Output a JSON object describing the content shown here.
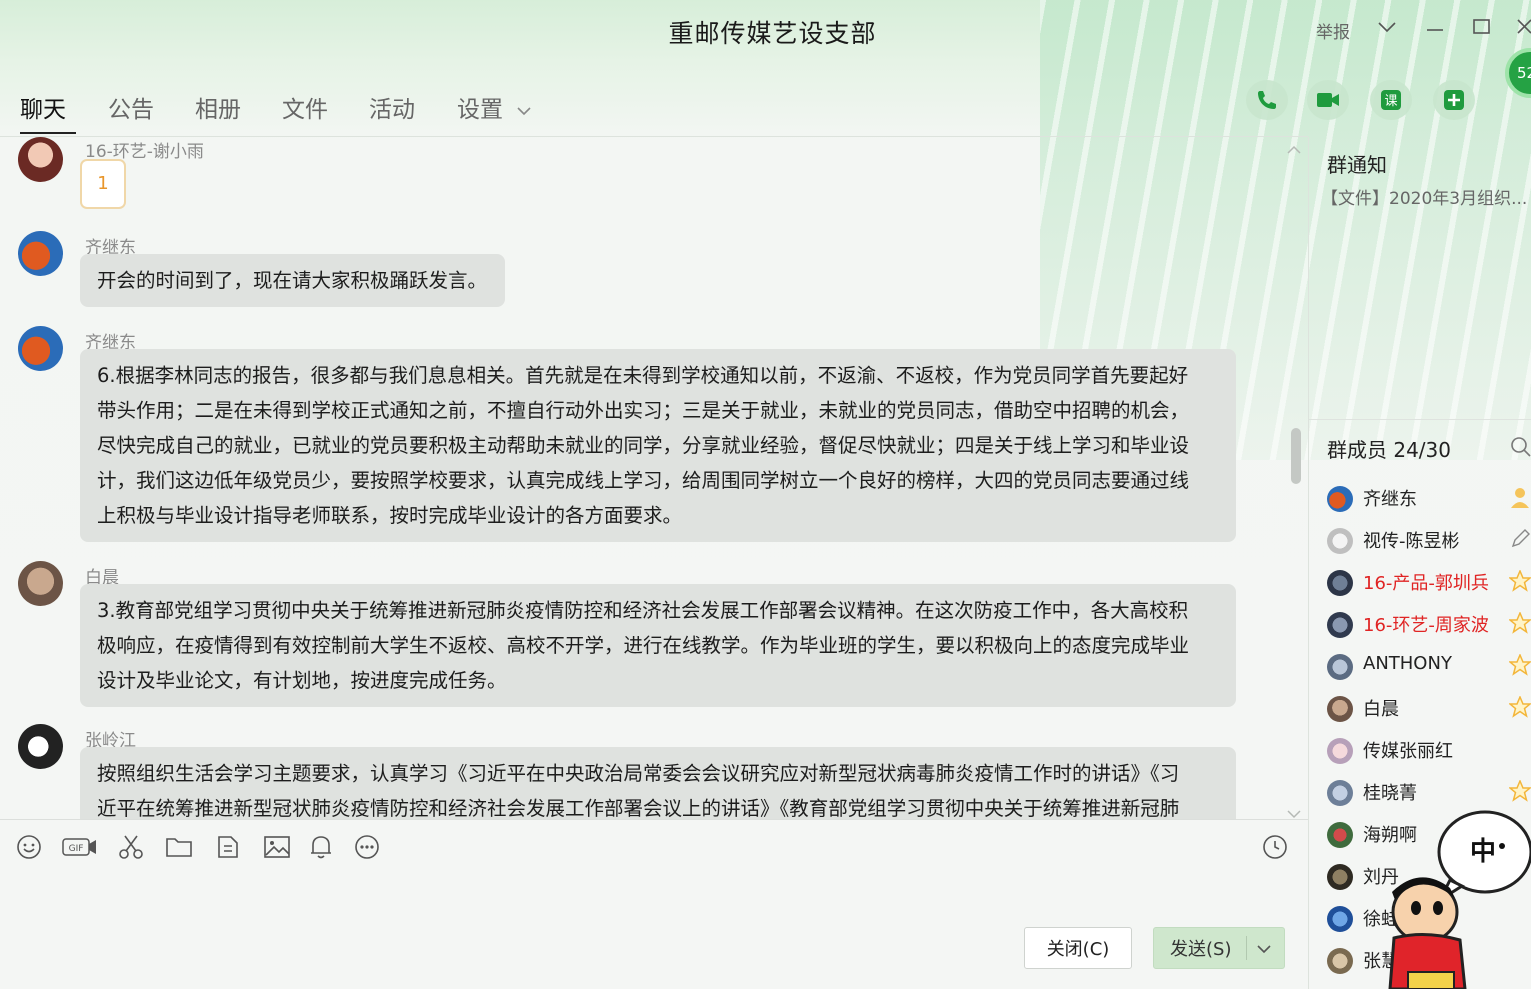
{
  "window": {
    "title": "重邮传媒艺设支部",
    "report_label": "举报"
  },
  "tabs": [
    {
      "label": "聊天",
      "active": true
    },
    {
      "label": "公告"
    },
    {
      "label": "相册"
    },
    {
      "label": "文件"
    },
    {
      "label": "活动"
    },
    {
      "label": "设置"
    }
  ],
  "header_badge": "52",
  "messages": [
    {
      "sender": "16-环艺-谢小雨",
      "emoji_value": "1"
    },
    {
      "sender": "齐继东",
      "lines": [
        "开会的时间到了，现在请大家积极踊跃发言。"
      ]
    },
    {
      "sender": "齐继东",
      "lines": [
        "6.根据李林同志的报告，很多都与我们息息相关。首先就是在未得到学校通知以前，不返渝、不返校，作为党员同学首先要起好",
        "带头作用；二是在未得到学校正式通知之前，不擅自行动外出实习；三是关于就业，未就业的党员同志，借助空中招聘的机会，",
        "尽快完成自己的就业，已就业的党员要积极主动帮助未就业的同学，分享就业经验，督促尽快就业；四是关于线上学习和毕业设",
        "计，我们这边低年级党员少，要按照学校要求，认真完成线上学习，给周围同学树立一个良好的榜样，大四的党员同志要通过线",
        "上积极与毕业设计指导老师联系，按时完成毕业设计的各方面要求。"
      ]
    },
    {
      "sender": "白晨",
      "lines": [
        "3.教育部党组学习贯彻中央关于统筹推进新冠肺炎疫情防控和经济社会发展工作部署会议精神。在这次防疫工作中，各大高校积",
        "极响应，在疫情得到有效控制前大学生不返校、高校不开学，进行在线教学。作为毕业班的学生，要以积极向上的态度完成毕业",
        "设计及毕业论文，有计划地，按进度完成任务。"
      ]
    },
    {
      "sender": "张岭江",
      "lines": [
        "按照组织生活会学习主题要求，认真学习《习近平在中央政治局常委会会议研究应对新型冠状病毒肺炎疫情工作时的讲话》《习",
        "近平在统筹推进新型冠状肺炎疫情防控和经济社会发展工作部署会议上的讲话》《教育部党组学习贯彻中央关于统筹推进新冠肺"
      ]
    }
  ],
  "buttons": {
    "close": "关闭(C)",
    "send": "发送(S)"
  },
  "notice": {
    "title": "群通知",
    "text": "【文件】2020年3月组织..."
  },
  "members": {
    "header": "群成员 24/30",
    "list": [
      {
        "name": "齐继东",
        "red": false,
        "badge": "owner"
      },
      {
        "name": "视传-陈昱彬",
        "red": false,
        "badge": "edit"
      },
      {
        "name": "16-产品-郭圳兵",
        "red": true,
        "badge": "star"
      },
      {
        "name": "16-环艺-周家波",
        "red": true,
        "badge": "star"
      },
      {
        "name": "ANTHONY",
        "red": false,
        "badge": "star"
      },
      {
        "name": "白晨",
        "red": false,
        "badge": "star"
      },
      {
        "name": "传媒张丽红",
        "red": false,
        "badge": ""
      },
      {
        "name": "桂晓菁",
        "red": false,
        "badge": "star"
      },
      {
        "name": "海朔啊",
        "red": false,
        "badge": ""
      },
      {
        "name": "刘丹",
        "red": false,
        "badge": ""
      },
      {
        "name": "徐蛙",
        "red": false,
        "badge": ""
      },
      {
        "name": "张慧",
        "red": false,
        "badge": ""
      }
    ]
  },
  "sticker_text": "中"
}
